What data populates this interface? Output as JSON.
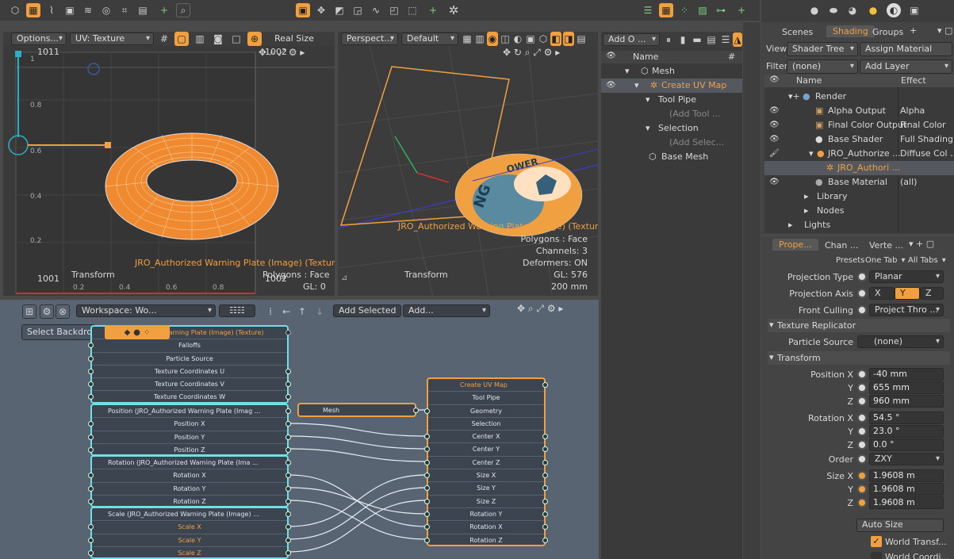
{
  "main_toolbar": {
    "layouts_icons": [
      "cube-icon",
      "cube-select-icon",
      "curve-icon",
      "camera-icon",
      "wave-icon",
      "frame-icon",
      "bracket-icon",
      "image-icon",
      "plus-icon",
      "magnify-icon"
    ],
    "center_icons": [
      "box-active-icon",
      "move-icon",
      "uv-icon",
      "lasso-icon",
      "paint-icon",
      "dotted-box-icon",
      "plus-icon",
      "star-icon"
    ],
    "right_icons": [
      "list-icon",
      "grid-active-icon",
      "scatter-icon",
      "image-icon",
      "nodes-icon",
      "plus-icon"
    ]
  },
  "uv_viewport": {
    "options_label": "Options...",
    "uv_dropdown": "UV: Texture",
    "real_size_label": "Real Size",
    "top_left_label": "1011",
    "top_right_label": "1002",
    "bottom_left_label": "1001",
    "bottom_right_label": "1002",
    "y_ticks": [
      "1",
      "0.8",
      "0.6",
      "0.4",
      "0.2"
    ],
    "x_ticks": [
      "0.2",
      "0.4",
      "0.6",
      "0.8"
    ],
    "transform_label": "Transform",
    "texture_label": "JRO_Authorized Warning Plate (Image) (Texture)",
    "polygons_label": "Polygons : Face",
    "gl_label": "GL: 0"
  },
  "persp_viewport": {
    "view_dropdown": "Perspect...",
    "shading_dropdown": "Default",
    "texture_label": "JRO_Authorized Warning Plate (Image) (Texture)",
    "polygons_label": "Polygons : Face",
    "channels_label": "Channels: 3",
    "deformers_label": "Deformers: ON",
    "gl_label": "GL: 576",
    "size_label": "200 mm",
    "transform_label": "Transform"
  },
  "schematic": {
    "workspace_dropdown": "Workspace: Wo...",
    "add_selected_label": "Add Selected",
    "add_dropdown": "Add...",
    "select_backdrop": "Select Backdrop",
    "texture_node": {
      "title": "Warning Plate (Image) (Texture)",
      "rows": [
        "Falloffs",
        "Particle Source",
        "Texture Coordinates U",
        "Texture Coordinates V",
        "Texture Coordinates W"
      ]
    },
    "position_node": {
      "title": "Position (JRO_Authorized Warning Plate (Imag ...",
      "rows": [
        "Position X",
        "Position Y",
        "Position Z"
      ]
    },
    "rotation_node": {
      "title": "Rotation (JRO_Authorized Warning Plate (Ima ...",
      "rows": [
        "Rotation X",
        "Rotation Y",
        "Rotation Z"
      ]
    },
    "scale_node": {
      "title": "Scale (JRO_Authorized Warning Plate (Image) ...",
      "rows": [
        "Scale X",
        "Scale Y",
        "Scale Z"
      ]
    },
    "mesh_node": {
      "title": "Mesh"
    },
    "uvmap_node": {
      "title": "Create UV Map",
      "rows": [
        "Tool Pipe",
        "Geometry",
        "Selection",
        "Center X",
        "Center Y",
        "Center Z",
        "Size X",
        "Size Y",
        "Size Z",
        "Rotation Y",
        "Rotation X",
        "Rotation Z"
      ]
    }
  },
  "item_list": {
    "add_dropdown": "Add O ...",
    "col_name": "Name",
    "col_hash": "#",
    "items": [
      {
        "label": "Mesh",
        "indent": 1
      },
      {
        "label": "Create UV Map",
        "indent": 2,
        "selected": true
      },
      {
        "label": "Tool Pipe",
        "indent": 3
      },
      {
        "label": "(Add Tool ...",
        "indent": 4,
        "dim": true
      },
      {
        "label": "Selection",
        "indent": 3
      },
      {
        "label": "(Add Selec...",
        "indent": 4,
        "dim": true
      },
      {
        "label": "Base Mesh",
        "indent": 2
      }
    ]
  },
  "shader_panel": {
    "tabs": [
      "Scenes",
      "Shading",
      "Groups"
    ],
    "active_tab": "Shading",
    "view_label": "View",
    "view_value": "Shader Tree",
    "assign_material": "Assign Material",
    "filter_label": "Filter",
    "filter_value": "(none)",
    "add_layer": "Add Layer",
    "col_name": "Name",
    "col_effect": "Effect",
    "rows": [
      {
        "name": "Render",
        "effect": ""
      },
      {
        "name": "Alpha Output",
        "effect": "Alpha"
      },
      {
        "name": "Final Color Output",
        "effect": "Final Color"
      },
      {
        "name": "Base Shader",
        "effect": "Full Shading"
      },
      {
        "name": "JRO_Authorize ...",
        "effect": "Diffuse Col ..."
      },
      {
        "name": "JRO_Authori ...",
        "effect": ""
      },
      {
        "name": "Base Material",
        "effect": "(all)"
      },
      {
        "name": "Library",
        "effect": ""
      },
      {
        "name": "Nodes",
        "effect": ""
      },
      {
        "name": "Lights",
        "effect": ""
      }
    ]
  },
  "properties": {
    "tabs": [
      "Prope...",
      "Chan ...",
      "Verte ..."
    ],
    "presets_label": "Presets",
    "one_tab": "One Tab",
    "all_tabs": "All Tabs",
    "projection_type_label": "Projection Type",
    "projection_type_value": "Planar",
    "projection_axis_label": "Projection Axis",
    "axis_options": [
      "X",
      "Y",
      "Z"
    ],
    "axis_selected": "Y",
    "front_culling_label": "Front Culling",
    "front_culling_value": "Project Thro ...",
    "texture_replicator_label": "Texture Replicator",
    "particle_source_label": "Particle Source",
    "particle_source_value": "(none)",
    "transform_label": "Transform",
    "position_label": "Position X",
    "position": [
      "-40 mm",
      "655 mm",
      "960 mm"
    ],
    "rotation_label": "Rotation X",
    "rotation": [
      "54.5 °",
      "23.0 °",
      "0.0 °"
    ],
    "order_label": "Order",
    "order_value": "ZXY",
    "size_label": "Size X",
    "size": [
      "1.9608 m",
      "1.9608 m",
      "1.9608 m"
    ],
    "y_label": "Y",
    "z_label": "Z",
    "auto_size": "Auto Size",
    "world_transform": "World Transf...",
    "world_coord": "World Coordi..."
  }
}
